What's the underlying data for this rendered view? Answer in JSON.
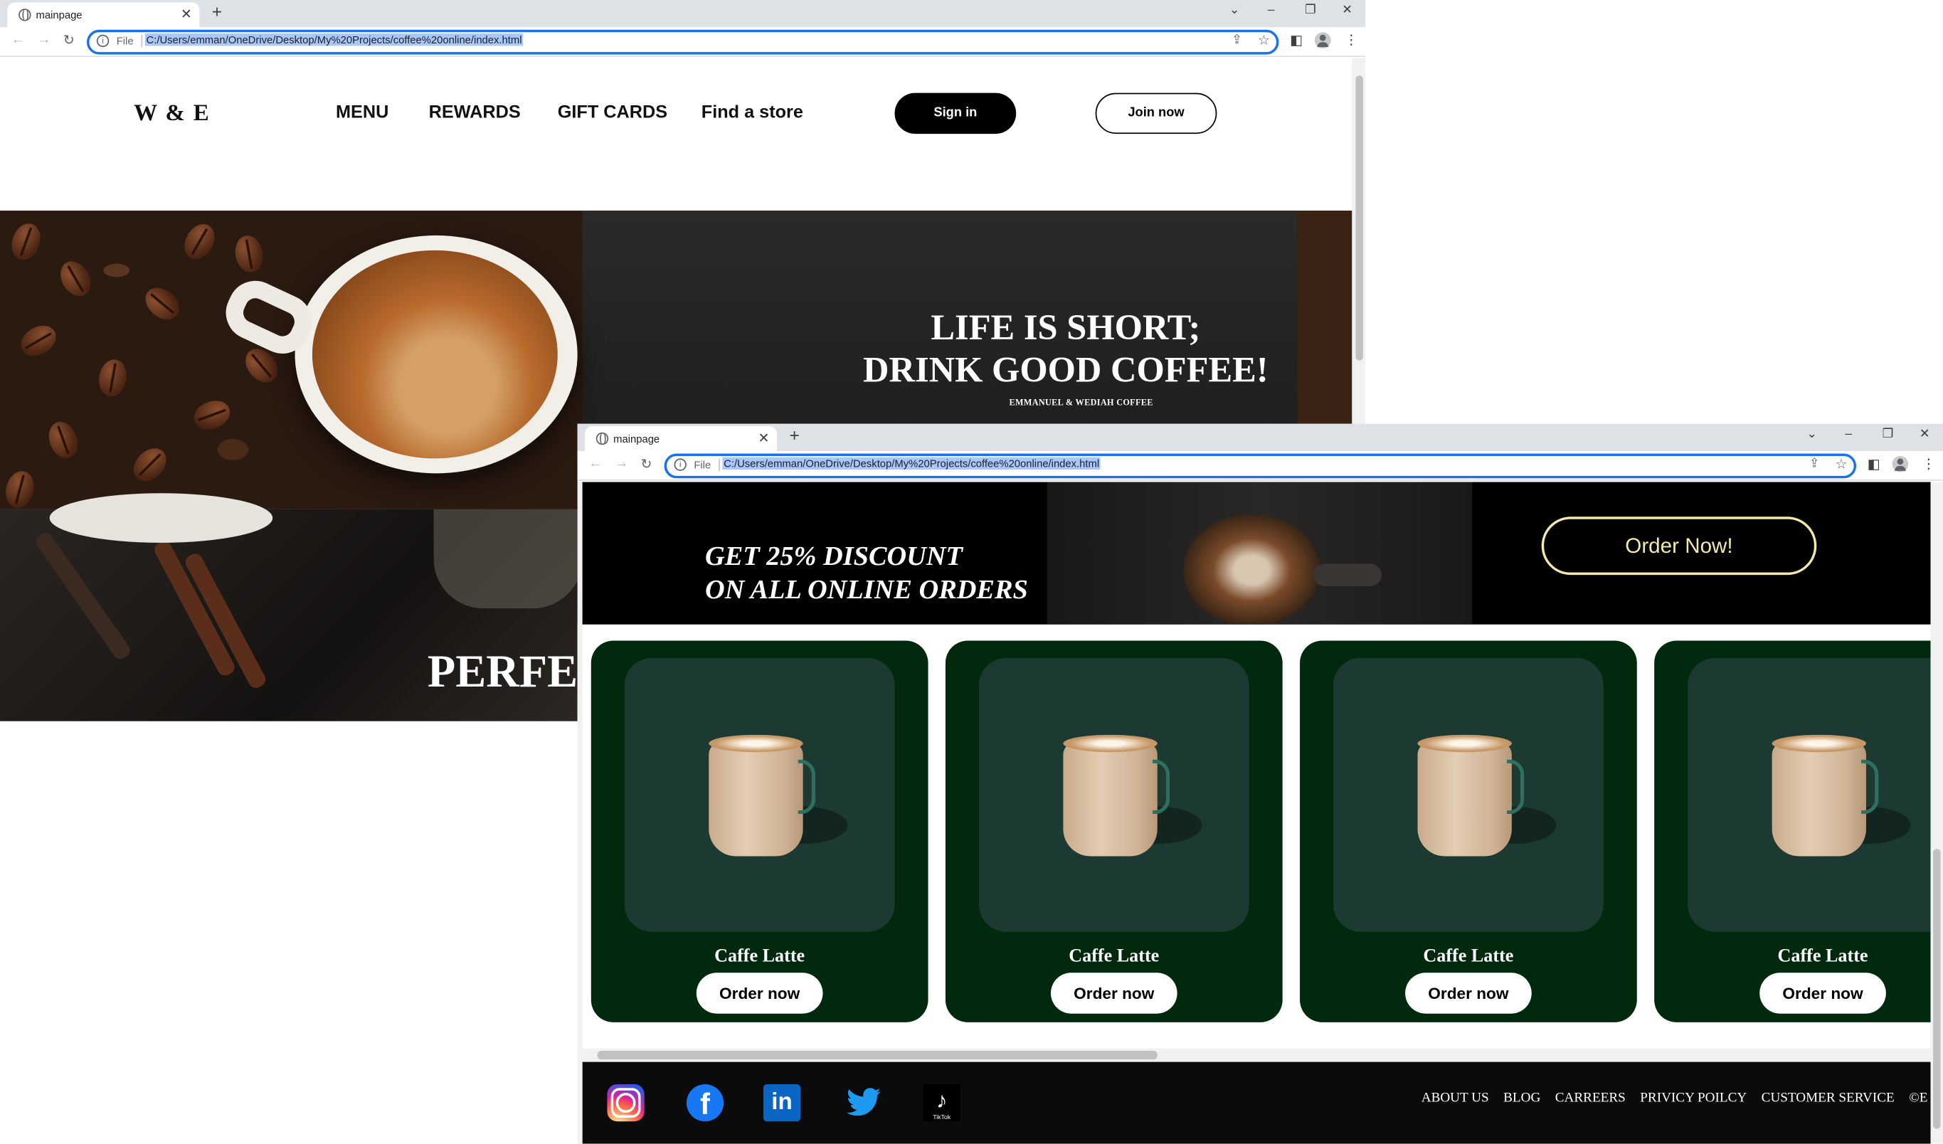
{
  "windowA": {
    "tab_title": "mainpage",
    "file_label": "File",
    "url": "C:/Users/emman/OneDrive/Desktop/My%20Projects/coffee%20online/index.html",
    "brand": "W & E",
    "nav": [
      "MENU",
      "REWARDS",
      "GIFT CARDS",
      "Find a store"
    ],
    "signin_label": "Sign in",
    "join_label": "Join now",
    "hero_title_line1": "LIFE IS SHORT;",
    "hero_title_line2": "DRINK GOOD COFFEE!",
    "hero_subtitle": "EMMANUEL & WEDIAH COFFEE",
    "hero2_title": "PERFE"
  },
  "windowB": {
    "tab_title": "mainpage",
    "file_label": "File",
    "url": "C:/Users/emman/OneDrive/Desktop/My%20Projects/coffee%20online/index.html",
    "promo_line1": "GET 25% DISCOUNT",
    "promo_line2": "ON ALL ONLINE ORDERS",
    "promo_button": "Order Now!",
    "products": [
      {
        "name": "Caffe Latte",
        "button": "Order now"
      },
      {
        "name": "Caffe Latte",
        "button": "Order now"
      },
      {
        "name": "Caffe Latte",
        "button": "Order now"
      },
      {
        "name": "Caffe Latte",
        "button": "Order now"
      }
    ],
    "social": [
      "instagram-icon",
      "facebook-icon",
      "linkedin-icon",
      "twitter-icon",
      "tiktok-icon"
    ],
    "tiktok_label": "TikTok",
    "footer_links": [
      "ABOUT US",
      "BLOG",
      "CARREERS",
      "PRIVICY POILCY",
      "CUSTOMER SERVICE",
      "©E & W"
    ]
  },
  "colors": {
    "card_bg": "#00290d",
    "card_image_bg": "#1c3a32",
    "promo_button": "#f3e9a8",
    "omnibox_focus": "#1a73e8",
    "url_selection": "#a8c7fa"
  }
}
